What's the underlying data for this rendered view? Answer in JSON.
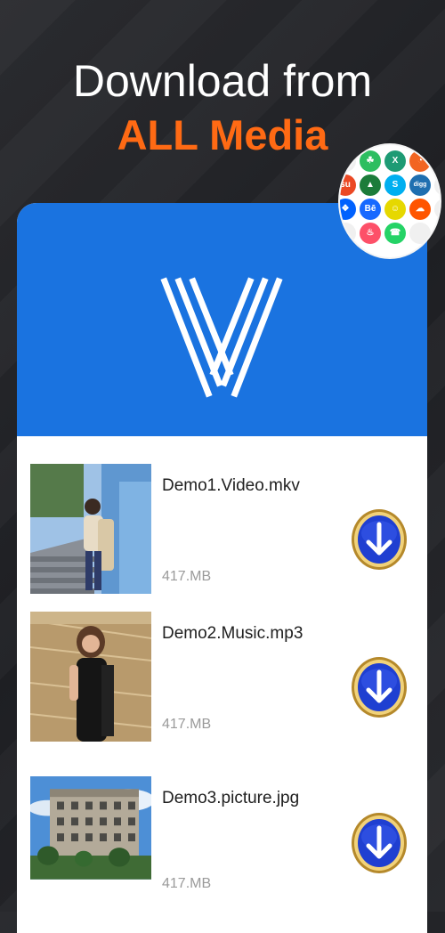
{
  "headline": {
    "line1": "Download from",
    "line2": "ALL Media"
  },
  "app": {
    "logo_letter": "V",
    "banner_color": "#1a73e0"
  },
  "social_badge": {
    "icons": [
      {
        "name": "evernote-icon",
        "glyph": "☘",
        "color": "#2dbe60"
      },
      {
        "name": "xing-icon",
        "glyph": "X",
        "color": "#1e9b74"
      },
      {
        "name": "rss-icon",
        "glyph": "◔",
        "color": "#f26522"
      },
      {
        "name": "stumbleupon-icon",
        "glyph": "su",
        "color": "#eb4924"
      },
      {
        "name": "arrow-icon",
        "glyph": "▲",
        "color": "#1c7c3a"
      },
      {
        "name": "skype-icon",
        "glyph": "S",
        "color": "#00aff0"
      },
      {
        "name": "digg-icon",
        "glyph": "digg",
        "color": "#1f6fb0"
      },
      {
        "name": "dropbox-icon",
        "glyph": "❖",
        "color": "#0061fe"
      },
      {
        "name": "behance-icon",
        "glyph": "Bē",
        "color": "#1769ff"
      },
      {
        "name": "snapchat-icon",
        "glyph": "☺",
        "color": "#e6d800"
      },
      {
        "name": "soundcloud-icon",
        "glyph": "☁",
        "color": "#ff5500"
      },
      {
        "name": "tinder-icon",
        "glyph": "♨",
        "color": "#fd5068"
      },
      {
        "name": "whatsapp-icon",
        "glyph": "☎",
        "color": "#25d366"
      }
    ]
  },
  "downloads": [
    {
      "filename": "Demo1.Video.mkv",
      "size": "417.MB",
      "thumb": "girl-stairs"
    },
    {
      "filename": "Demo2.Music.mp3",
      "size": "417.MB",
      "thumb": "girl-saree"
    },
    {
      "filename": "Demo3.picture.jpg",
      "size": "417.MB",
      "thumb": "building"
    }
  ],
  "colors": {
    "accent_orange": "#ff6a14",
    "download_button_blue": "#1f3fd1",
    "download_button_ring": "#d6b24a"
  }
}
